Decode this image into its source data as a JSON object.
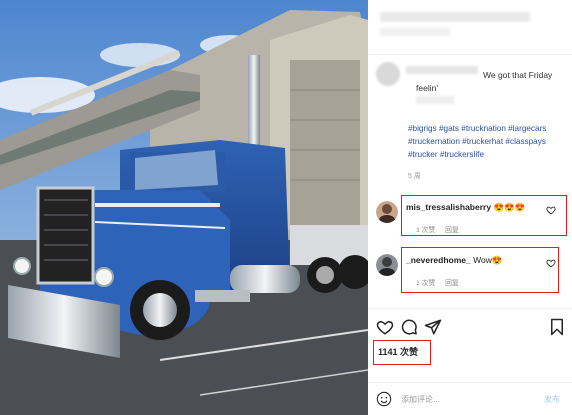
{
  "caption": {
    "text_line1": "We got that Friday",
    "text_line2": "feelin'",
    "hashtags": [
      "#bigrigs",
      "#gats",
      "#trucknation",
      "#largecars",
      "#truckernation",
      "#truckerhat",
      "#classpays",
      "#trucker",
      "#truckerslife"
    ],
    "time": "5 周"
  },
  "comments": [
    {
      "username": "mis_tressalishaberry",
      "text": "😍😍😍",
      "likes": "1 次赞",
      "reply": "回复"
    },
    {
      "username": "_neveredhome_",
      "text": "Wow😍",
      "likes": "1 次赞",
      "reply": "回复"
    }
  ],
  "likes_count": "1141 次赞",
  "add_comment": {
    "placeholder": "添加评论...",
    "post_label": "发布"
  },
  "icons": {
    "like": "heart-icon",
    "comment": "comment-icon",
    "share": "share-icon",
    "save": "bookmark-icon",
    "emoji": "emoji-icon"
  },
  "colors": {
    "highlight_box": "#e01c1c",
    "hashtag": "#2b4fa8",
    "post_button": "#a8c8f0"
  }
}
